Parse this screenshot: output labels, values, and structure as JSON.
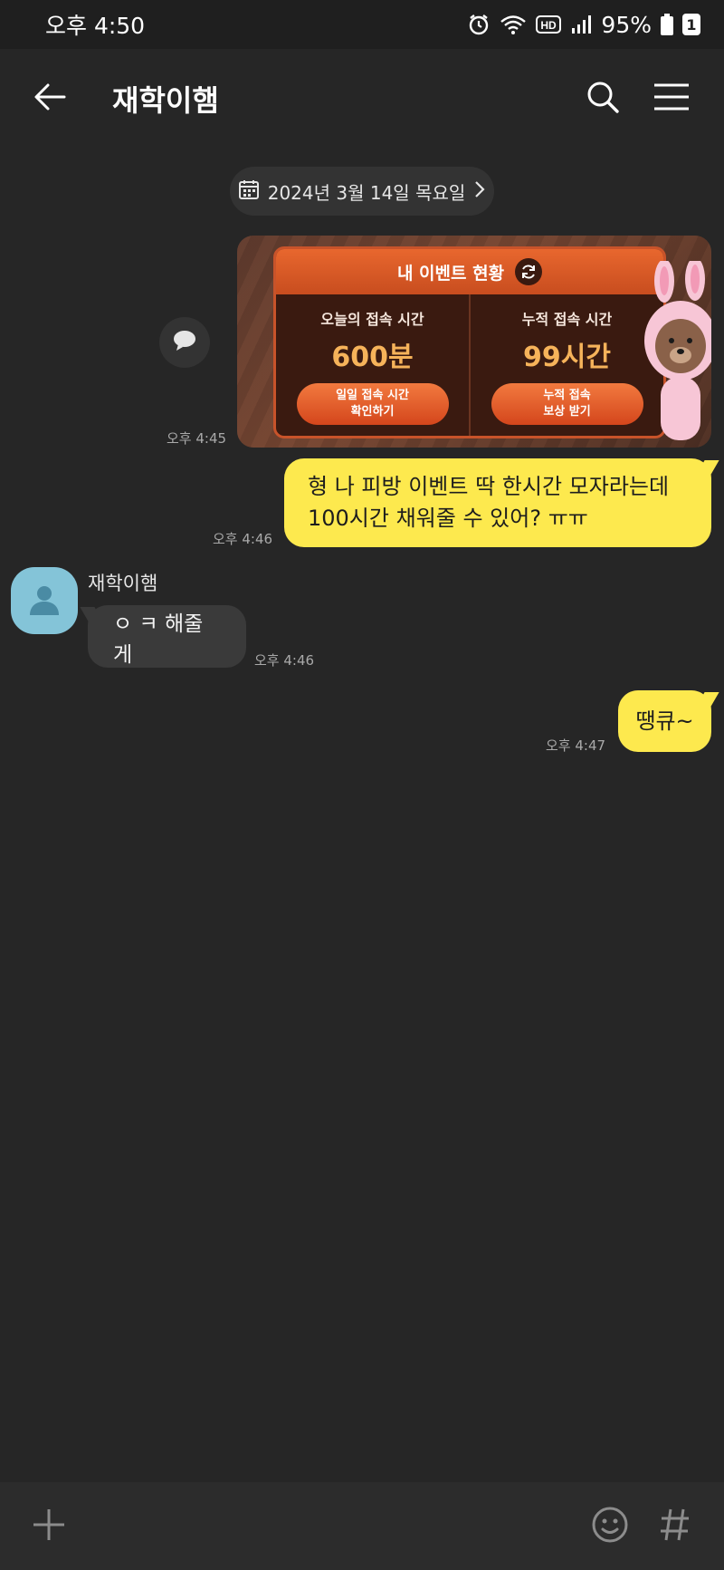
{
  "status_bar": {
    "time": "오후 4:50",
    "battery_percent": "95%",
    "notification_count": "1",
    "icons": [
      "alarm-icon",
      "wifi-icon",
      "hd-icon",
      "signal-icon",
      "battery-icon"
    ]
  },
  "header": {
    "title": "재학이햄",
    "icons": [
      "back-arrow-icon",
      "search-icon",
      "menu-icon"
    ]
  },
  "date_divider": {
    "label": "2024년 3월 14일 목요일"
  },
  "event_card": {
    "heading": "내 이벤트 현황",
    "columns": [
      {
        "label": "오늘의 접속 시간",
        "value": "600분",
        "button": "일일 접속 시간\n확인하기"
      },
      {
        "label": "누적 접속 시간",
        "value": "99시간",
        "button": "누적 접속\n보상 받기"
      }
    ],
    "time": "오후 4:45"
  },
  "messages": [
    {
      "from": "me",
      "lines": [
        "형 나 피방 이벤트 딱 한시간 모자라는데",
        "100시간 채워줄 수 있어? ㅠㅠ"
      ],
      "time": "오후 4:46"
    },
    {
      "from": "other",
      "sender": "재학이햄",
      "text": "ㅇ ㅋ 해줄게",
      "time": "오후 4:46"
    },
    {
      "from": "me",
      "text": "땡큐~",
      "time": "오후 4:47"
    }
  ],
  "input_bar": {
    "icons": [
      "plus-icon",
      "emoji-icon",
      "hashtag-icon"
    ]
  },
  "colors": {
    "background": "#262626",
    "my_bubble": "#fde94e",
    "other_bubble": "#3a3a3a",
    "avatar": "#84c4d8"
  }
}
